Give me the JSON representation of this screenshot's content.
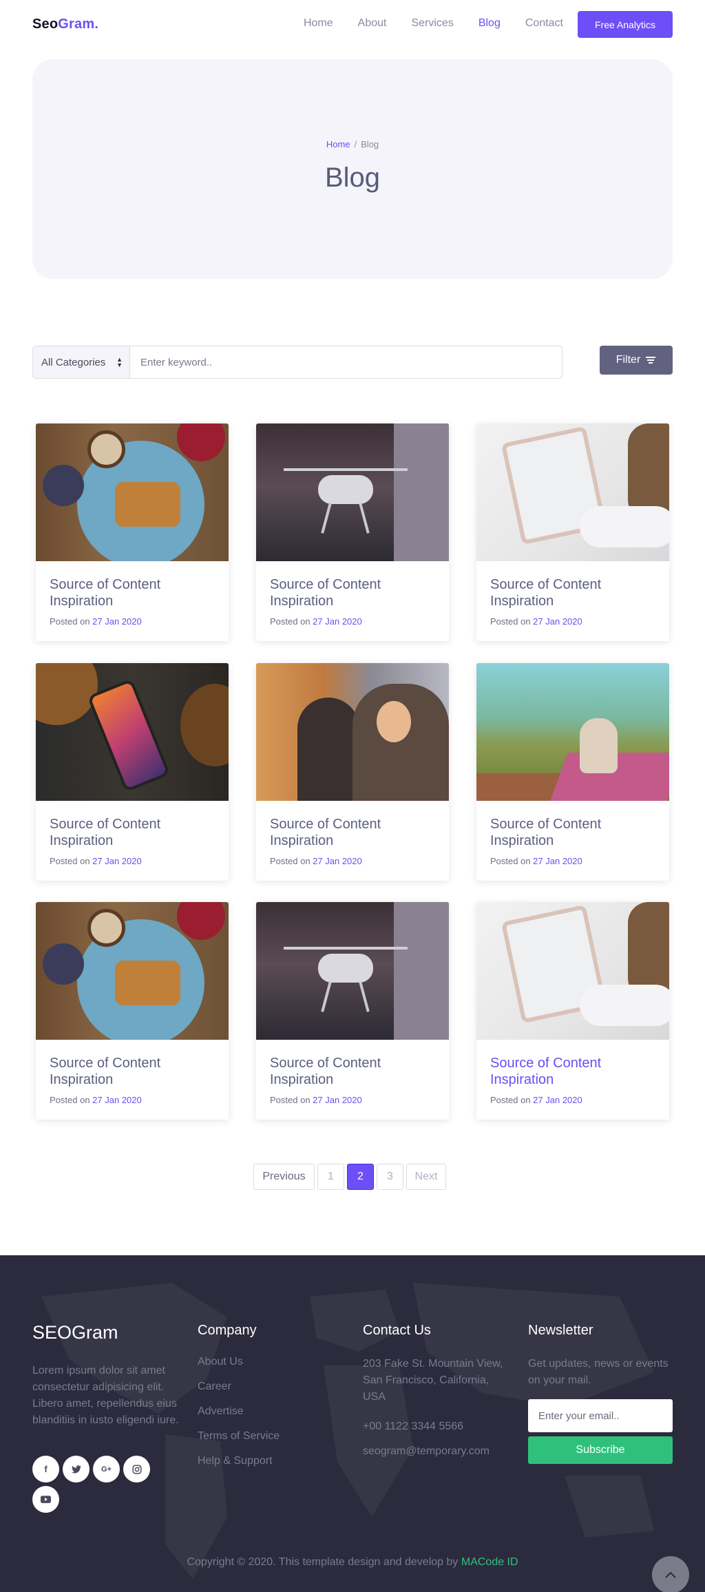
{
  "nav": {
    "brand_part1": "Seo",
    "brand_part2": "Gram.",
    "items": [
      "Home",
      "About",
      "Services",
      "Blog",
      "Contact"
    ],
    "active": "Blog",
    "cta_label": "Free Analytics"
  },
  "hero": {
    "breadcrumb_home": "Home",
    "breadcrumb_sep": "/",
    "breadcrumb_current": "Blog",
    "title": "Blog"
  },
  "search": {
    "category_value": "All Categories",
    "keyword_placeholder": "Enter keyword..",
    "filter_label": "Filter"
  },
  "posts": [
    {
      "image": "breakfast-photo",
      "title": "Source of Content Inspiration",
      "posted_label": "Posted on",
      "date": "27 Jan 2020"
    },
    {
      "image": "drone-photo",
      "title": "Source of Content Inspiration",
      "posted_label": "Posted on",
      "date": "27 Jan 2020"
    },
    {
      "image": "tablet-photo",
      "title": "Source of Content Inspiration",
      "posted_label": "Posted on",
      "date": "27 Jan 2020"
    },
    {
      "image": "smartphone-photo",
      "title": "Source of Content Inspiration",
      "posted_label": "Posted on",
      "date": "27 Jan 2020"
    },
    {
      "image": "friends-photo",
      "title": "Source of Content Inspiration",
      "posted_label": "Posted on",
      "date": "27 Jan 2020"
    },
    {
      "image": "picnic-photo",
      "title": "Source of Content Inspiration",
      "posted_label": "Posted on",
      "date": "27 Jan 2020"
    },
    {
      "image": "breakfast-photo",
      "title": "Source of Content Inspiration",
      "posted_label": "Posted on",
      "date": "27 Jan 2020"
    },
    {
      "image": "drone-photo",
      "title": "Source of Content Inspiration",
      "posted_label": "Posted on",
      "date": "27 Jan 2020"
    },
    {
      "image": "tablet-photo",
      "title": "Source of Content Inspiration",
      "posted_label": "Posted on",
      "date": "27 Jan 2020",
      "highlighted": true
    }
  ],
  "pagination": {
    "previous": "Previous",
    "pages": [
      "1",
      "2",
      "3"
    ],
    "current": "2",
    "next": "Next"
  },
  "footer": {
    "brand": "SEOGram",
    "about": "Lorem ipsum dolor sit amet consectetur adipisicing elit. Libero amet, repellendus eius blanditiis in iusto eligendi iure.",
    "socials": [
      "facebook-icon",
      "twitter-icon",
      "google-plus-icon",
      "instagram-icon",
      "youtube-icon"
    ],
    "company_heading": "Company",
    "company_links": [
      "About Us",
      "Career",
      "Advertise",
      "Terms of Service",
      "Help & Support"
    ],
    "contact_heading": "Contact Us",
    "address": "203 Fake St. Mountain View, San Francisco, California, USA",
    "phone": "+00 1122 3344 5566",
    "email": "seogram@temporary.com",
    "newsletter_heading": "Newsletter",
    "newsletter_text": "Get updates, news or events on your mail.",
    "email_placeholder": "Enter your email..",
    "subscribe_label": "Subscribe",
    "copyright": "Copyright © 2020. This template design and develop by",
    "copyright_link": "MACode ID"
  },
  "colors": {
    "accent": "#6c4ff6",
    "footer_bg": "#2c2b3d",
    "subscribe": "#2fc17c",
    "filter_btn": "#626280"
  }
}
